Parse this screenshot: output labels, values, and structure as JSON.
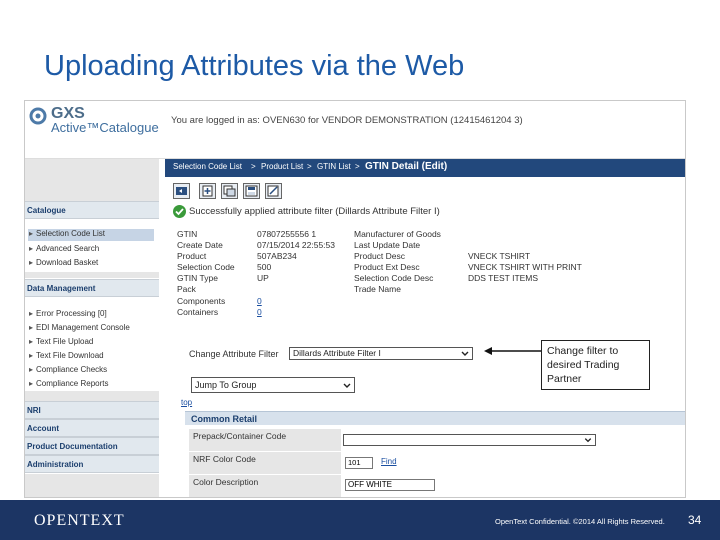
{
  "slide": {
    "title": "Uploading Attributes via the Web",
    "footer_logo": "OPENTEXT",
    "footer_confidential": "OpenText Confidential. ©2014 All Rights Reserved.",
    "page_number": "34"
  },
  "app": {
    "logo_brand": "GXS",
    "logo_product": "Active™Catalogue",
    "login_info": "You are logged in as: OVEN630 for VENDOR DEMONSTRATION (12415461204 3)",
    "breadcrumb": {
      "item1": "Selection Code List",
      "sep": ">",
      "item2": "Product List",
      "item3": "GTIN List",
      "current": "GTIN Detail (Edit)"
    },
    "success_message": "Successfully applied attribute filter (Dillards Attribute Filter I)"
  },
  "sidebar": {
    "catalogue_head": "Catalogue",
    "catalogue_items": [
      "Selection Code List",
      "Advanced Search",
      "Download Basket"
    ],
    "data_mgmt_head": "Data Management",
    "data_mgmt_items": [
      "Error Processing [0]",
      "EDI Management Console",
      "Text File Upload",
      "Text File Download",
      "Compliance Checks",
      "Compliance Reports"
    ],
    "nri": "NRI",
    "account": "Account",
    "product_doc": "Product Documentation",
    "administration": "Administration"
  },
  "details": {
    "left_labels": [
      "GTIN",
      "Create Date",
      "Product",
      "Selection Code",
      "GTIN Type",
      "Pack",
      "Components",
      "Containers"
    ],
    "left_values": [
      "07807255556 1",
      "07/15/2014 22:55:53",
      "507AB234",
      "500",
      "UP",
      "",
      "0",
      "0"
    ],
    "right_labels": [
      "Manufacturer of Goods",
      "Last Update Date",
      "Product Desc",
      "Product Ext Desc",
      "Selection Code Desc",
      "Trade Name"
    ],
    "right_values": [
      "",
      "",
      "VNECK TSHIRT",
      "VNECK TSHIRT WITH PRINT",
      "DDS TEST ITEMS",
      ""
    ]
  },
  "filter": {
    "label": "Change Attribute Filter",
    "value": "Dillards Attribute Filter I",
    "jump_value": "Jump To Group",
    "top_link": "top"
  },
  "attributes": {
    "group": "Common Retail",
    "rows": [
      "Prepack/Container Code",
      "NRF Color Code",
      "Color Description"
    ],
    "nrf_value": "101",
    "find_label": "Find",
    "color_value": "OFF WHITE"
  },
  "callout": {
    "text": "Change filter to desired Trading Partner"
  },
  "colors": {
    "title": "#1d5aa6",
    "nav_bar": "#22487c",
    "footer": "#1c3564",
    "link": "#1a4ea0"
  }
}
